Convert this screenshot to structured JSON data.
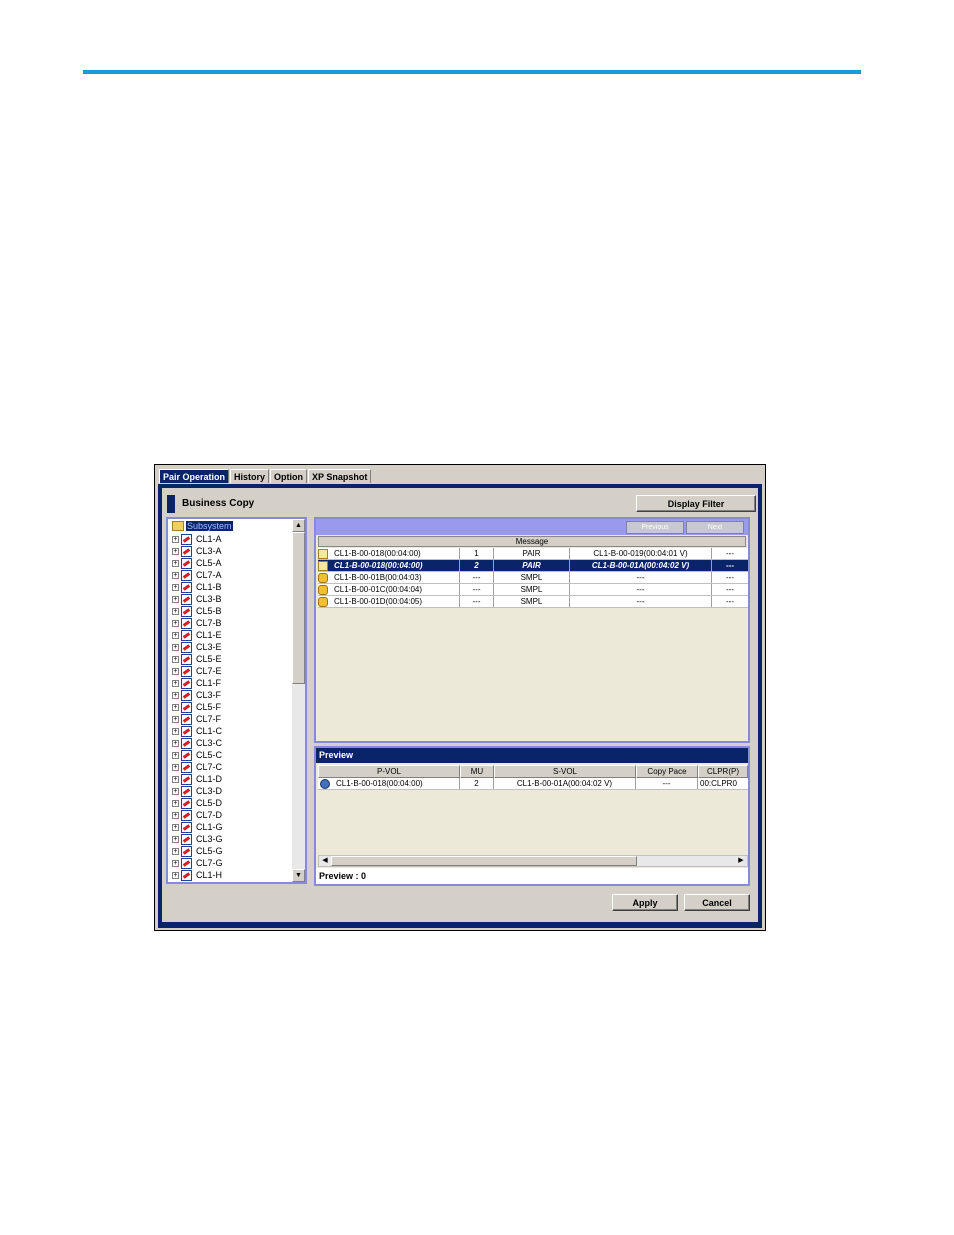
{
  "tabs": [
    "Pair Operation",
    "History",
    "Option",
    "XP Snapshot"
  ],
  "active_tab_index": 0,
  "header": {
    "title": "Business Copy",
    "display_filter": "Display Filter"
  },
  "tree": {
    "root": "Subsystem",
    "items": [
      "CL1-A",
      "CL3-A",
      "CL5-A",
      "CL7-A",
      "CL1-B",
      "CL3-B",
      "CL5-B",
      "CL7-B",
      "CL1-E",
      "CL3-E",
      "CL5-E",
      "CL7-E",
      "CL1-F",
      "CL3-F",
      "CL5-F",
      "CL7-F",
      "CL1-C",
      "CL3-C",
      "CL5-C",
      "CL7-C",
      "CL1-D",
      "CL3-D",
      "CL5-D",
      "CL7-D",
      "CL1-G",
      "CL3-G",
      "CL5-G",
      "CL7-G",
      "CL1-H"
    ]
  },
  "pair_panel": {
    "nav": [
      "Previous",
      "Next"
    ],
    "message_header": "Message",
    "rows": [
      {
        "icon": "document-volume-icon",
        "pvol": "CL1-B-00-018(00:04:00)",
        "mu": "1",
        "status": "PAIR",
        "svol": "CL1-B-00-019(00:04:01 V)",
        "extra": "---",
        "selected": false
      },
      {
        "icon": "document-volume-icon",
        "pvol": "CL1-B-00-018(00:04:00)",
        "mu": "2",
        "status": "PAIR",
        "svol": "CL1-B-00-01A(00:04:02 V)",
        "extra": "---",
        "selected": true
      },
      {
        "icon": "cylinder-volume-icon",
        "pvol": "CL1-B-00-01B(00:04:03)",
        "mu": "---",
        "status": "SMPL",
        "svol": "---",
        "extra": "---",
        "selected": false
      },
      {
        "icon": "cylinder-volume-icon",
        "pvol": "CL1-B-00-01C(00:04:04)",
        "mu": "---",
        "status": "SMPL",
        "svol": "---",
        "extra": "---",
        "selected": false
      },
      {
        "icon": "cylinder-volume-icon",
        "pvol": "CL1-B-00-01D(00:04:05)",
        "mu": "---",
        "status": "SMPL",
        "svol": "---",
        "extra": "---",
        "selected": false
      }
    ]
  },
  "preview": {
    "title": "Preview",
    "columns": [
      "P-VOL",
      "MU",
      "S-VOL",
      "Copy Pace",
      "CLPR(P)"
    ],
    "row": {
      "pvol": "CL1-B-00-018(00:04:00)",
      "mu": "2",
      "svol": "CL1-B-00-01A(00:04:02 V)",
      "pace": "---",
      "clpr": "00:CLPR0"
    },
    "footer": "Preview : 0"
  },
  "buttons": {
    "apply": "Apply",
    "cancel": "Cancel"
  }
}
